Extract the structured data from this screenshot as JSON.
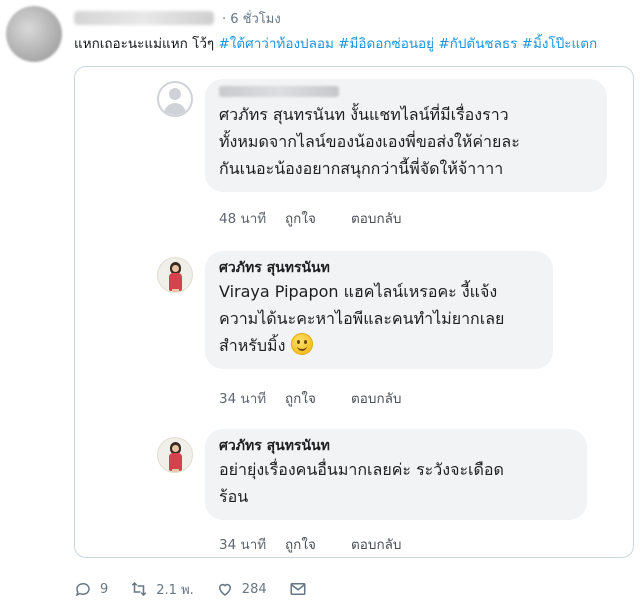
{
  "tweet": {
    "time": "· 6 ชั่วโมง",
    "text": "แหกเถอะนะแม่แหก โว้ๆ",
    "hashtags": [
      "#ใต้ศาว่าท้องปลอม",
      "#มีอิดอกซ่อนอยู่",
      "#กัปตันชลธร",
      "#มิ้งโป๊ะแตก"
    ]
  },
  "comments": [
    {
      "author": "",
      "lines": [
        "ศวภัทร สุนทรนันท งั้นแชทไลน์ที่มีเรื่องราว",
        "ทั้งหมดจากไลน์ของน้องเองพี่ขอส่งให้ค่ายละ",
        "กันเนอะน้องอยากสนุกกว่านี้พี่จัดให้จ้าาาา"
      ],
      "time": "48 นาที",
      "like": "ถูกใจ",
      "reply": "ตอบกลับ"
    },
    {
      "author": "ศวภัทร สุนทรนันท",
      "lines": [
        "Viraya Pipapon แฮคไลน์เหรอคะ งี้แจ้ง",
        "ความได้นะคะหาไอพีและคนทำไม่ยากเลย",
        "สำหรับมิ้ง"
      ],
      "time": "34 นาที",
      "like": "ถูกใจ",
      "reply": "ตอบกลับ"
    },
    {
      "author": "ศวภัทร สุนทรนันท",
      "lines": [
        "อย่ายุ่งเรื่องคนอื่นมากเลยค่ะ ระวังจะเดือด",
        "ร้อน"
      ],
      "time": "34 นาที",
      "like": "ถูกใจ",
      "reply": "ตอบกลับ"
    }
  ],
  "actions": {
    "reply_count": "9",
    "retweet_count": "2.1 พ.",
    "like_count": "284"
  },
  "colors": {
    "hashtag": "#1b95e0",
    "bubble": "#f2f3f5",
    "border": "#ccd6dd"
  }
}
